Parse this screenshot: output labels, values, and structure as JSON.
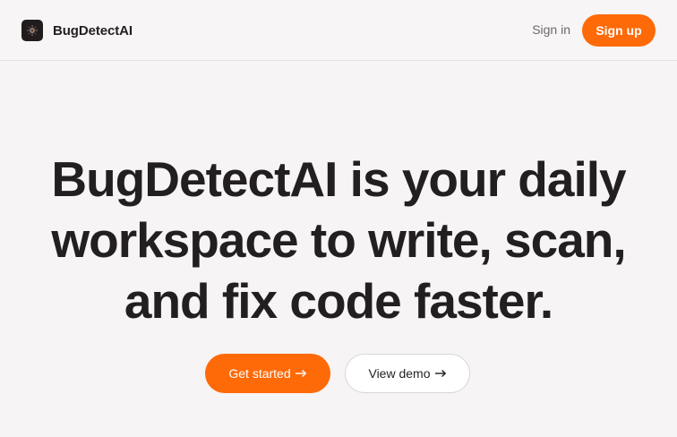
{
  "header": {
    "brand_name": "BugDetectAI",
    "logo_icon": "bug-scan-icon",
    "signin_label": "Sign in",
    "signup_label": "Sign up"
  },
  "hero": {
    "title_line1": "BugDetectAI is your daily",
    "title_line2": "workspace to write, scan,",
    "title_line3": "and fix code faster."
  },
  "cta": {
    "primary_label": "Get started",
    "primary_icon": "arrow-right-icon",
    "secondary_label": "View demo",
    "secondary_icon": "arrow-right-icon"
  },
  "colors": {
    "accent": "#ff6a08",
    "background": "#f6f4f4",
    "text": "#231f20",
    "muted_text": "#6d6869"
  }
}
